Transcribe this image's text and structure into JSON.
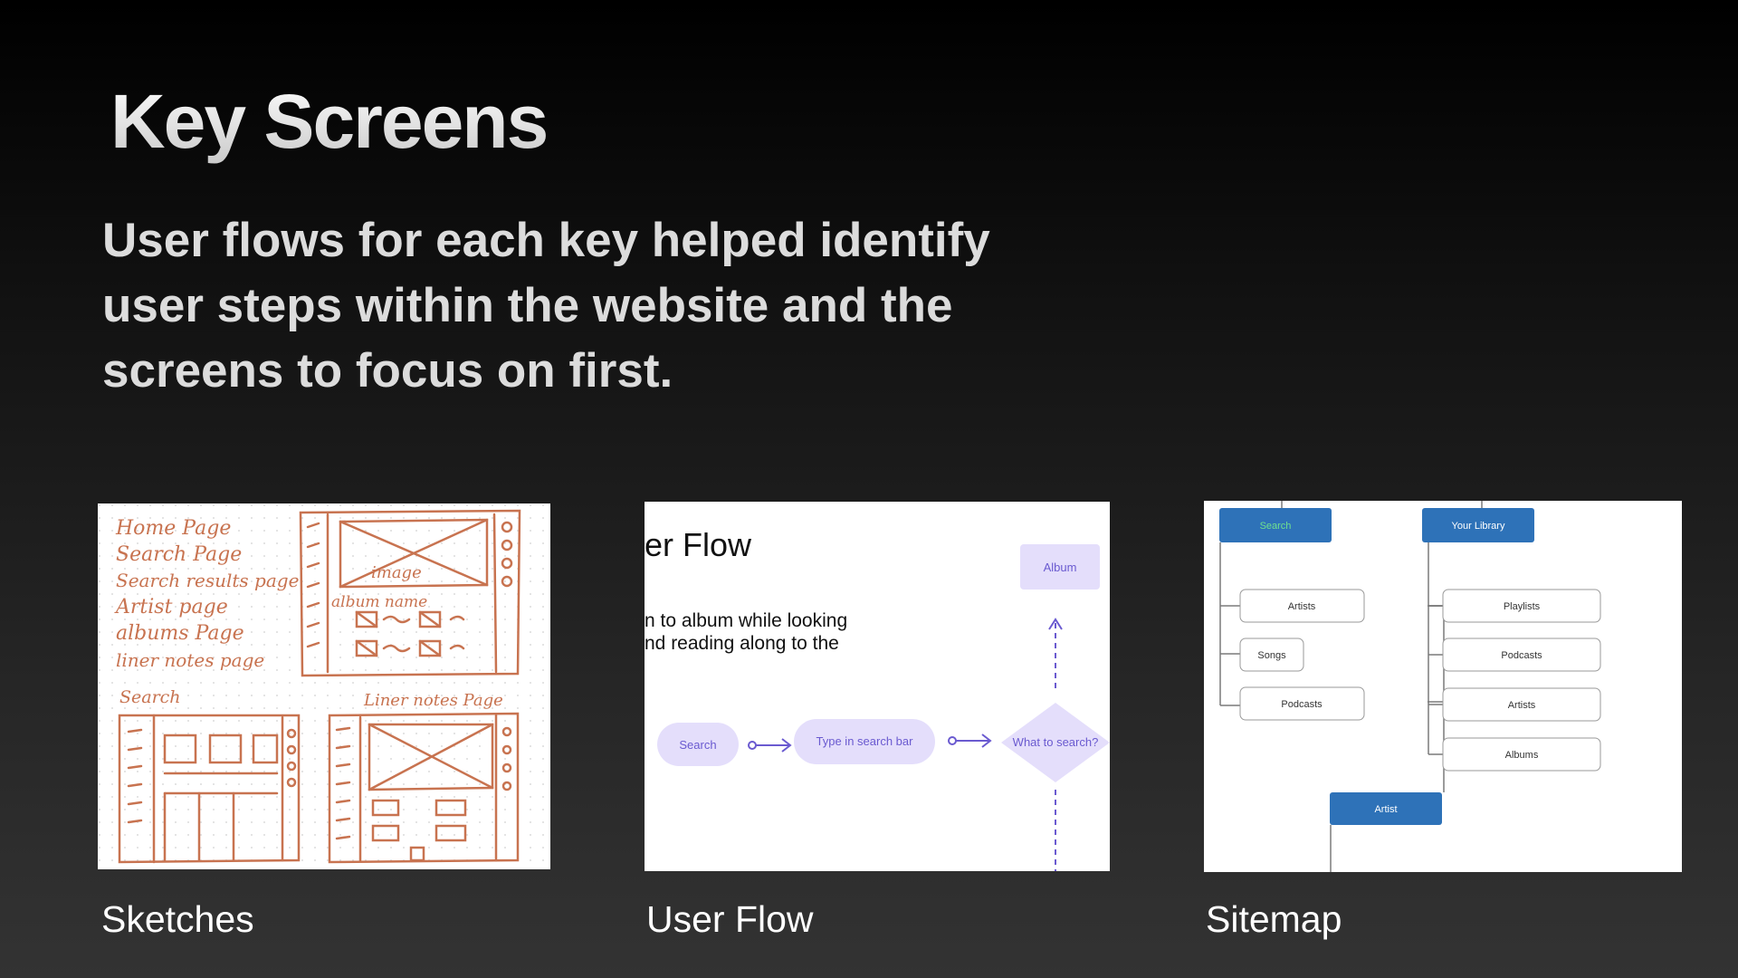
{
  "slide": {
    "title": "Key Screens",
    "subtitle": "User flows for each key helped identify user steps within the website and the screens to focus on first."
  },
  "cards": [
    {
      "caption": "Sketches",
      "sketch": {
        "lines": [
          "Home Page",
          "Search Page",
          "Search results page",
          "Artist page",
          "albums Page",
          "liner notes page",
          "Search"
        ],
        "image_label": "image",
        "album_name_label": "album name",
        "liner_notes_label": "Liner notes Page"
      }
    },
    {
      "caption": "User Flow",
      "flow": {
        "heading": "er Flow",
        "desc_line1": "n to album while looking",
        "desc_line2": "nd reading along to the",
        "album": "Album",
        "search": "Search",
        "type_in": "Type in search bar",
        "what": "What to search?"
      }
    },
    {
      "caption": "Sitemap",
      "sitemap": {
        "search": "Search",
        "library": "Your Library",
        "search_children": [
          "Artists",
          "Songs",
          "Podcasts"
        ],
        "library_children": [
          "Playlists",
          "Podcasts",
          "Artists",
          "Albums"
        ],
        "artist": "Artist"
      }
    }
  ],
  "colors": {
    "sketch_ink": "#c87350",
    "flow_purple": "#e4defb",
    "flow_text": "#6a5ad0",
    "sitemap_blue": "#2e72b8",
    "sitemap_green": "#6fe08f"
  }
}
